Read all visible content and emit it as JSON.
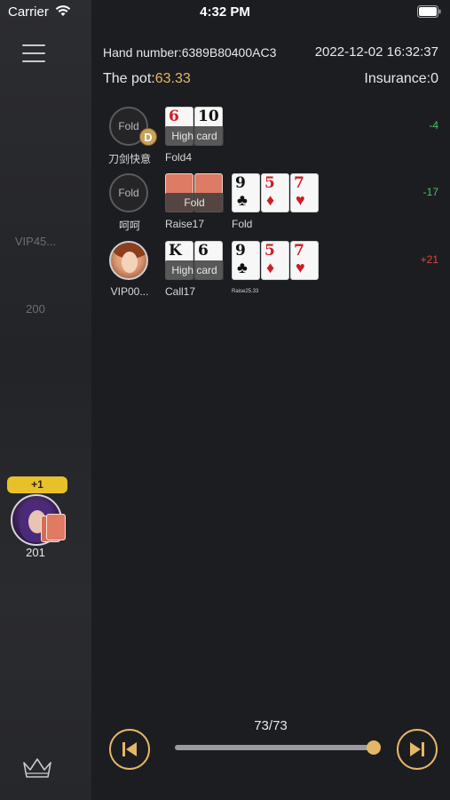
{
  "status_bar": {
    "carrier": "Carrier",
    "time": "4:32 PM"
  },
  "sidebar": {
    "seat_vip_name": "VIP45...",
    "seat_chips": "200",
    "hero": {
      "gain_badge": "+1",
      "stack": "201"
    }
  },
  "hand": {
    "hand_number": "Hand number:6389B80400AC3",
    "datetime": "2022-12-02 16:32:37",
    "pot_label": "The pot:",
    "pot_value": "63.33",
    "insurance": "Insurance:0"
  },
  "players": [
    {
      "name": "刀剑快意",
      "avatar_text": "Fold",
      "dealer": "D",
      "hole_cards": [
        {
          "rank": "6",
          "suit": "♦",
          "color": "red"
        },
        {
          "rank": "10",
          "suit": "♠",
          "color": "black"
        }
      ],
      "hand_label": "High card",
      "action": "Fold4",
      "board": [],
      "board_action": "",
      "result": "-4"
    },
    {
      "name": "呵呵",
      "avatar_text": "Fold",
      "hole_cards": "hidden",
      "hand_label": "Fold",
      "action": "Raise17",
      "board": [
        {
          "rank": "9",
          "suit": "♣",
          "color": "black"
        },
        {
          "rank": "5",
          "suit": "♦",
          "color": "red"
        },
        {
          "rank": "7",
          "suit": "♥",
          "color": "red"
        }
      ],
      "board_action": "Fold",
      "result": "-17"
    },
    {
      "name": "VIP00...",
      "hole_cards": [
        {
          "rank": "K",
          "suit": "♠",
          "color": "black"
        },
        {
          "rank": "6",
          "suit": "♠",
          "color": "black"
        }
      ],
      "hand_label": "High card",
      "action": "Call17",
      "board": [
        {
          "rank": "9",
          "suit": "♣",
          "color": "black"
        },
        {
          "rank": "5",
          "suit": "♦",
          "color": "red"
        },
        {
          "rank": "7",
          "suit": "♥",
          "color": "red"
        }
      ],
      "board_action": "Raise25.33",
      "result": "+21"
    }
  ],
  "replay": {
    "progress": "73/73",
    "position_fraction": 1.0
  },
  "icons": {
    "menu": "menu-icon",
    "crown": "crown-icon",
    "prev": "skip-back-icon",
    "next": "skip-forward-icon",
    "wifi": "wifi-icon",
    "battery": "battery-icon"
  },
  "colors": {
    "accent": "#e4b768",
    "loss": "#4cc06a",
    "win": "#e0453d"
  }
}
